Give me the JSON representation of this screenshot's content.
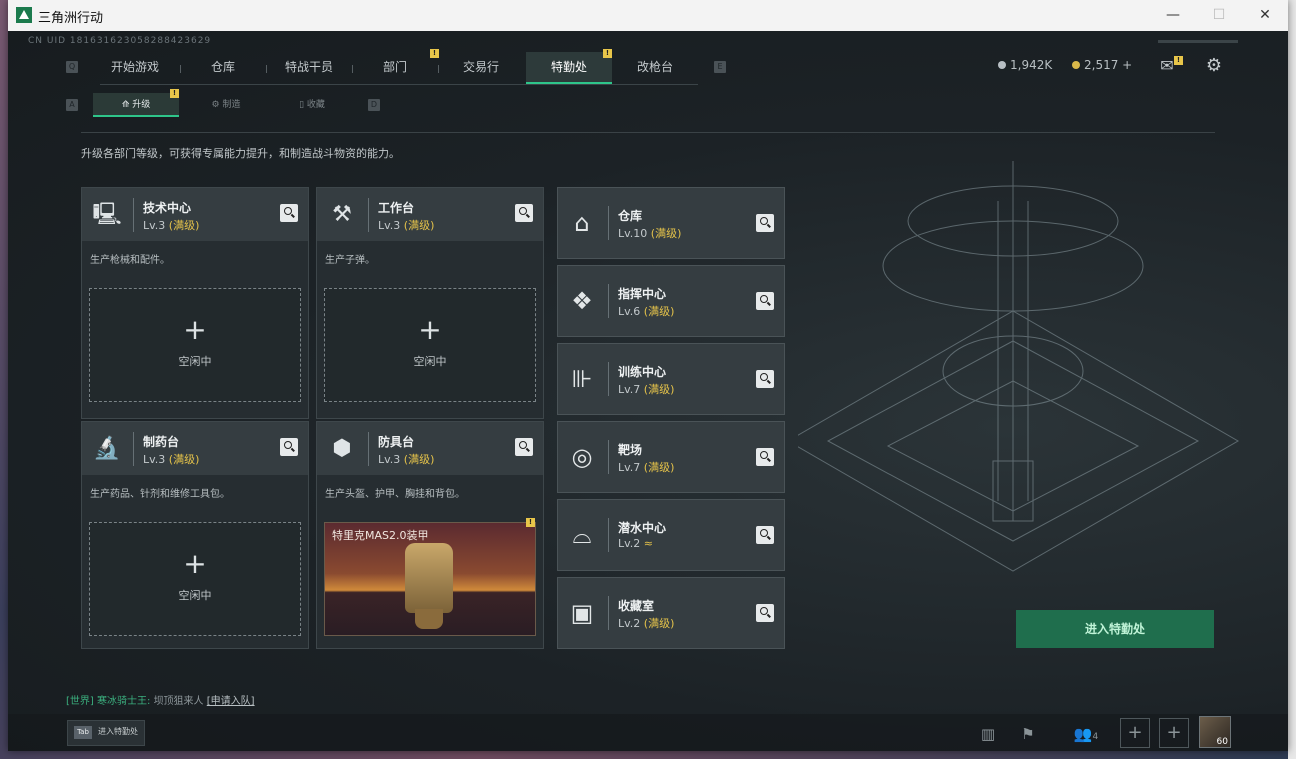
{
  "window": {
    "title": "三角洲行动",
    "minimize": "—",
    "maximize": "☐",
    "close": "✕"
  },
  "uid": "CN UID 181631623058288423629",
  "nav": {
    "left_key": "Q",
    "right_key": "E",
    "tabs": [
      {
        "label": "开始游戏"
      },
      {
        "label": "仓库"
      },
      {
        "label": "特战干员"
      },
      {
        "label": "部门",
        "badge": "!"
      },
      {
        "label": "交易行"
      },
      {
        "label": "特勤处",
        "badge": "!",
        "active": true
      },
      {
        "label": "改枪台"
      }
    ]
  },
  "currency": {
    "silver": "1,942K",
    "gold": "2,517 +",
    "mail_badge": "!"
  },
  "subnav": {
    "left_key": "A",
    "right_key": "D",
    "tabs": [
      {
        "label": "升级",
        "badge": "!",
        "active": true
      },
      {
        "label": "制造"
      },
      {
        "label": "收藏"
      }
    ]
  },
  "description": "升级各部门等级，可获得专属能力提升，和制造战斗物资的能力。",
  "workshops": [
    {
      "name": "技术中心",
      "level": "Lv.3",
      "max": "(满级)",
      "desc": "生产枪械和配件。",
      "slot_plus": "+",
      "slot_status": "空闲中",
      "icon": "computer-icon"
    },
    {
      "name": "工作台",
      "level": "Lv.3",
      "max": "(满级)",
      "desc": "生产子弹。",
      "slot_plus": "+",
      "slot_status": "空闲中",
      "icon": "tools-icon"
    },
    {
      "name": "制药台",
      "level": "Lv.3",
      "max": "(满级)",
      "desc": "生产药品、针剂和维修工具包。",
      "slot_plus": "+",
      "slot_status": "空闲中",
      "icon": "microscope-icon"
    },
    {
      "name": "防具台",
      "level": "Lv.3",
      "max": "(满级)",
      "desc": "生产头盔、护甲、胸挂和背包。",
      "item_name": "特里克MAS2.0装甲",
      "item_badge": "!",
      "icon": "cubes-icon"
    }
  ],
  "facilities": [
    {
      "name": "仓库",
      "level": "Lv.10",
      "max": "(满级)",
      "icon": "warehouse-icon"
    },
    {
      "name": "指挥中心",
      "level": "Lv.6",
      "max": "(满级)",
      "icon": "command-icon"
    },
    {
      "name": "训练中心",
      "level": "Lv.7",
      "max": "(满级)",
      "icon": "dumbbell-icon"
    },
    {
      "name": "靶场",
      "level": "Lv.7",
      "max": "(满级)",
      "icon": "target-icon"
    },
    {
      "name": "潜水中心",
      "level": "Lv.2",
      "max": "≈",
      "icon": "diving-mask-icon"
    },
    {
      "name": "收藏室",
      "level": "Lv.2",
      "max": "(满级)",
      "icon": "vault-icon"
    }
  ],
  "enter_button": "进入特勤处",
  "chat": {
    "channel": "[世界]",
    "user": "寒冰骑士王:",
    "message": "坝顶狙来人",
    "link": "[申请入队]"
  },
  "tab_hint": {
    "key": "Tab",
    "label": "进入特勤处"
  },
  "bottom": {
    "squad_count": "4",
    "level": "60"
  },
  "colors": {
    "accent": "#2ec58a",
    "gold": "#e4c24a",
    "badge": "#e8c64a",
    "enter_button": "#1f6e4d"
  }
}
